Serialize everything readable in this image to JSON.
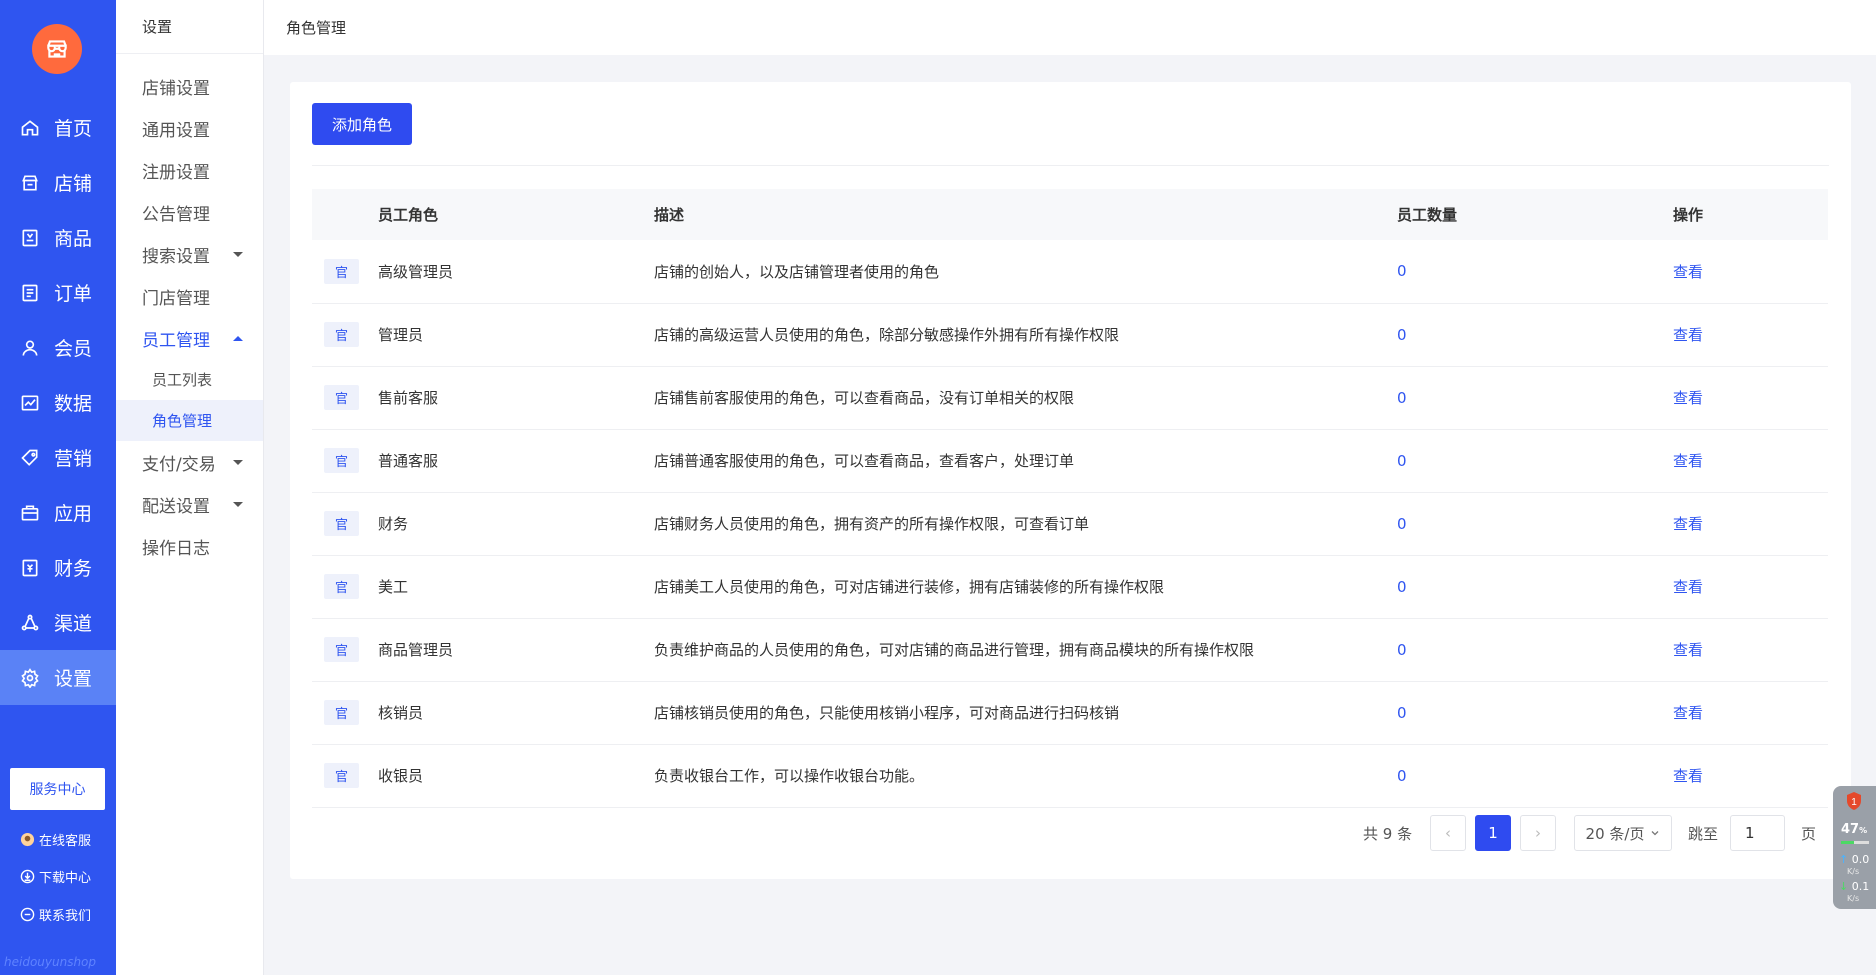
{
  "nav": {
    "items": [
      {
        "label": "首页",
        "icon": "home-icon"
      },
      {
        "label": "店铺",
        "icon": "store-icon"
      },
      {
        "label": "商品",
        "icon": "product-icon"
      },
      {
        "label": "订单",
        "icon": "order-icon"
      },
      {
        "label": "会员",
        "icon": "member-icon"
      },
      {
        "label": "数据",
        "icon": "chart-icon"
      },
      {
        "label": "营销",
        "icon": "tag-icon"
      },
      {
        "label": "应用",
        "icon": "app-icon"
      },
      {
        "label": "财务",
        "icon": "finance-icon"
      },
      {
        "label": "渠道",
        "icon": "channel-icon"
      },
      {
        "label": "设置",
        "icon": "gear-icon"
      }
    ],
    "active_index": 10,
    "service_center": "服务中心",
    "online_service": "在线客服",
    "download_center": "下载中心",
    "contact_us": "联系我们",
    "footer_text": "heidouyunshop",
    "accent_color": "#2f55f0",
    "logo_color": "#ff6a3d"
  },
  "sub": {
    "title": "设置",
    "items": [
      {
        "label": "店铺设置"
      },
      {
        "label": "通用设置"
      },
      {
        "label": "注册设置"
      },
      {
        "label": "公告管理"
      },
      {
        "label": "搜索设置"
      },
      {
        "label": "门店管理"
      },
      {
        "label": "员工管理"
      },
      {
        "label": "支付/交易"
      },
      {
        "label": "配送设置"
      },
      {
        "label": "操作日志"
      }
    ],
    "staff_children": [
      {
        "label": "员工列表"
      },
      {
        "label": "角色管理"
      }
    ]
  },
  "topbar": {
    "title": "角色管理"
  },
  "main": {
    "add_button": "添加角色",
    "columns": {
      "role": "员工角色",
      "desc": "描述",
      "count": "员工数量",
      "action": "操作"
    },
    "tag_label": "官",
    "action_label": "查看",
    "rows": [
      {
        "role": "高级管理员",
        "desc": "店铺的创始人，以及店铺管理者使用的角色",
        "count": "0"
      },
      {
        "role": "管理员",
        "desc": "店铺的高级运营人员使用的角色，除部分敏感操作外拥有所有操作权限",
        "count": "0"
      },
      {
        "role": "售前客服",
        "desc": "店铺售前客服使用的角色，可以查看商品，没有订单相关的权限",
        "count": "0"
      },
      {
        "role": "普通客服",
        "desc": "店铺普通客服使用的角色，可以查看商品，查看客户，处理订单",
        "count": "0"
      },
      {
        "role": "财务",
        "desc": "店铺财务人员使用的角色，拥有资产的所有操作权限，可查看订单",
        "count": "0"
      },
      {
        "role": "美工",
        "desc": "店铺美工人员使用的角色，可对店铺进行装修，拥有店铺装修的所有操作权限",
        "count": "0"
      },
      {
        "role": "商品管理员",
        "desc": "负责维护商品的人员使用的角色，可对店铺的商品进行管理，拥有商品模块的所有操作权限",
        "count": "0"
      },
      {
        "role": "核销员",
        "desc": "店铺核销员使用的角色，只能使用核销小程序，可对商品进行扫码核销",
        "count": "0"
      },
      {
        "role": "收银员",
        "desc": "负责收银台工作，可以操作收银台功能。",
        "count": "0"
      }
    ]
  },
  "pager": {
    "total": "共 9 条",
    "prev": "‹",
    "current": "1",
    "next": "›",
    "page_size": "20 条/页",
    "jump_label": "跳至",
    "jump_value": "1",
    "page_suffix": "页"
  },
  "monitor": {
    "badge": "1",
    "percent": "47",
    "percent_unit": "%",
    "cpu_fill": 0.47,
    "up_speed": "0.0",
    "up_unit": "K/s",
    "down_speed": "0.1",
    "down_unit": "K/s"
  }
}
